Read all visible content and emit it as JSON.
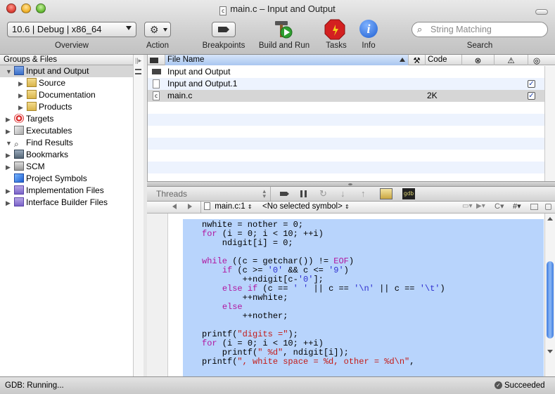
{
  "window": {
    "title": "main.c – Input and Output",
    "file_icon": "c"
  },
  "toolbar": {
    "overview_value": "10.6 | Debug | x86_64",
    "overview_label": "Overview",
    "action_label": "Action",
    "breakpoints_label": "Breakpoints",
    "build_run_label": "Build and Run",
    "tasks_label": "Tasks",
    "info_label": "Info",
    "search_placeholder": "String Matching",
    "search_label": "Search"
  },
  "sidebar": {
    "header": "Groups & Files",
    "items": [
      {
        "label": "Input and Output",
        "icon": "xcode-project-icon"
      },
      {
        "label": "Source",
        "icon": "folder-icon"
      },
      {
        "label": "Documentation",
        "icon": "folder-icon"
      },
      {
        "label": "Products",
        "icon": "folder-icon"
      },
      {
        "label": "Targets",
        "icon": "target-icon"
      },
      {
        "label": "Executables",
        "icon": "executables-icon"
      },
      {
        "label": "Find Results",
        "icon": "magnifier-icon"
      },
      {
        "label": "Bookmarks",
        "icon": "bookmarks-icon"
      },
      {
        "label": "SCM",
        "icon": "scm-icon"
      },
      {
        "label": "Project Symbols",
        "icon": "cube-icon"
      },
      {
        "label": "Implementation Files",
        "icon": "smart-group-icon"
      },
      {
        "label": "Interface Builder Files",
        "icon": "smart-group-icon"
      }
    ]
  },
  "filelist": {
    "columns": {
      "name": "File Name",
      "code": "Code"
    },
    "rows": [
      {
        "name": "Input and Output",
        "code": "",
        "checked": false
      },
      {
        "name": "Input and Output.1",
        "code": "",
        "checked": true
      },
      {
        "name": "main.c",
        "code": "2K",
        "checked": true
      }
    ]
  },
  "debugger": {
    "threads_label": "Threads"
  },
  "editor": {
    "file_popup": "main.c:1",
    "symbol_popup": "<No selected symbol>",
    "code_lines": [
      "nwhite = nother = 0;",
      "for (i = 0; i < 10; ++i)",
      "    ndigit[i] = 0;",
      "",
      "while ((c = getchar()) != EOF)",
      "    if (c >= '0' && c <= '9')",
      "        ++ndigit[c-'0'];",
      "    else if (c == ' ' || c == '\\n' || c == '\\t')",
      "        ++nwhite;",
      "    else",
      "        ++nother;",
      "",
      "printf(\"digits =\");",
      "for (i = 0; i < 10; ++i)",
      "    printf(\" %d\", ndigit[i]);",
      "printf(\", white space = %d, other = %d\\n\","
    ]
  },
  "status": {
    "left": "GDB: Running...",
    "right": "Succeeded"
  },
  "colors": {
    "selection": "#b8d4fc",
    "keyword": "#b0169f",
    "string": "#c41a16",
    "char": "#2f2fd0"
  }
}
